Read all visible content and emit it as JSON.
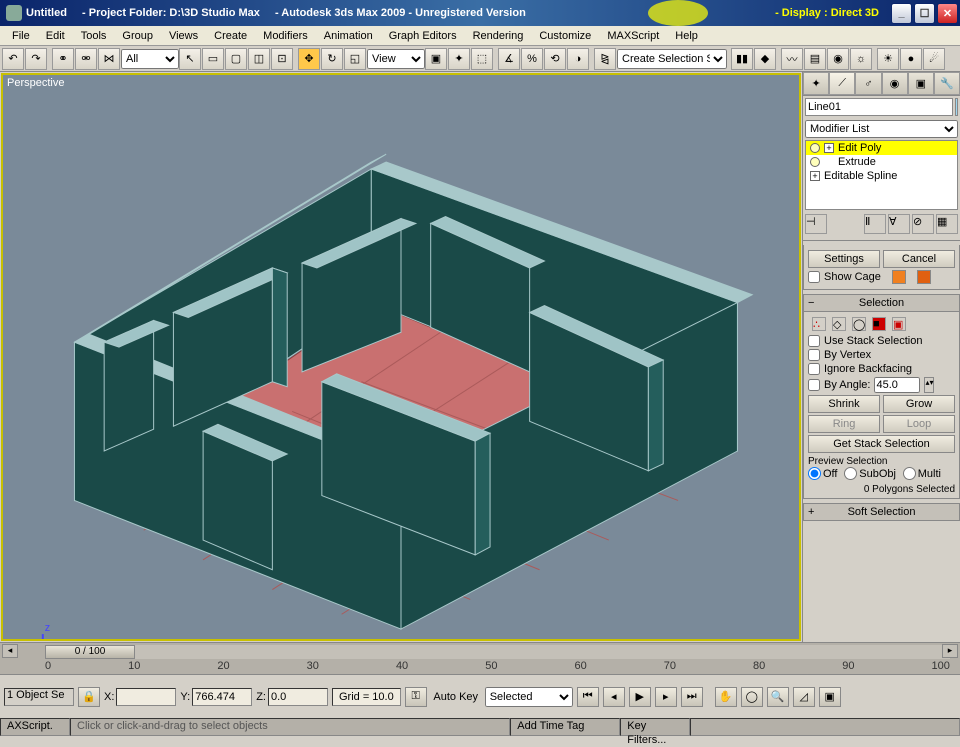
{
  "title": {
    "untitled": "Untitled",
    "folder": "- Project Folder: D:\\3D Studio Max",
    "app": "- Autodesk 3ds Max 2009 - Unregistered Version",
    "display": "- Display : Direct 3D"
  },
  "menu": [
    "File",
    "Edit",
    "Tools",
    "Group",
    "Views",
    "Create",
    "Modifiers",
    "Animation",
    "Graph Editors",
    "Rendering",
    "Customize",
    "MAXScript",
    "Help"
  ],
  "toolbar": {
    "filter": "All",
    "view": "View",
    "selset": "Create Selection Set"
  },
  "viewport": {
    "label": "Perspective"
  },
  "cmd": {
    "object_name": "Line01",
    "modlist": "Modifier List",
    "mods": {
      "editpoly": "Edit Poly",
      "extrude": "Extrude",
      "spline": "Editable Spline"
    },
    "settings": "Settings",
    "cancel": "Cancel",
    "showcage": "Show Cage",
    "selection_head": "Selection",
    "use_stack": "Use Stack Selection",
    "by_vertex": "By Vertex",
    "ignore_bf": "Ignore Backfacing",
    "by_angle": "By Angle:",
    "angle_val": "45.0",
    "shrink": "Shrink",
    "grow": "Grow",
    "ring": "Ring",
    "loop": "Loop",
    "getstack": "Get Stack Selection",
    "preview": "Preview Selection",
    "off": "Off",
    "subobj": "SubObj",
    "multi": "Multi",
    "polycount": "0 Polygons Selected",
    "softsel": "Soft Selection"
  },
  "track": {
    "frame": "0 / 100",
    "ticks": [
      "0",
      "10",
      "20",
      "30",
      "40",
      "50",
      "60",
      "70",
      "80",
      "90",
      "100"
    ]
  },
  "status": {
    "obj": "1 Object Se",
    "x": "",
    "y": "766.474",
    "z": "0.0",
    "grid": "Grid = 10.0",
    "autokey": "Auto Key",
    "mode": "Selected",
    "keyfilters": "Key Filters...",
    "maxscript": "AXScript.",
    "hint": "Click or click-and-drag to select objects",
    "addtag": "Add Time Tag"
  }
}
